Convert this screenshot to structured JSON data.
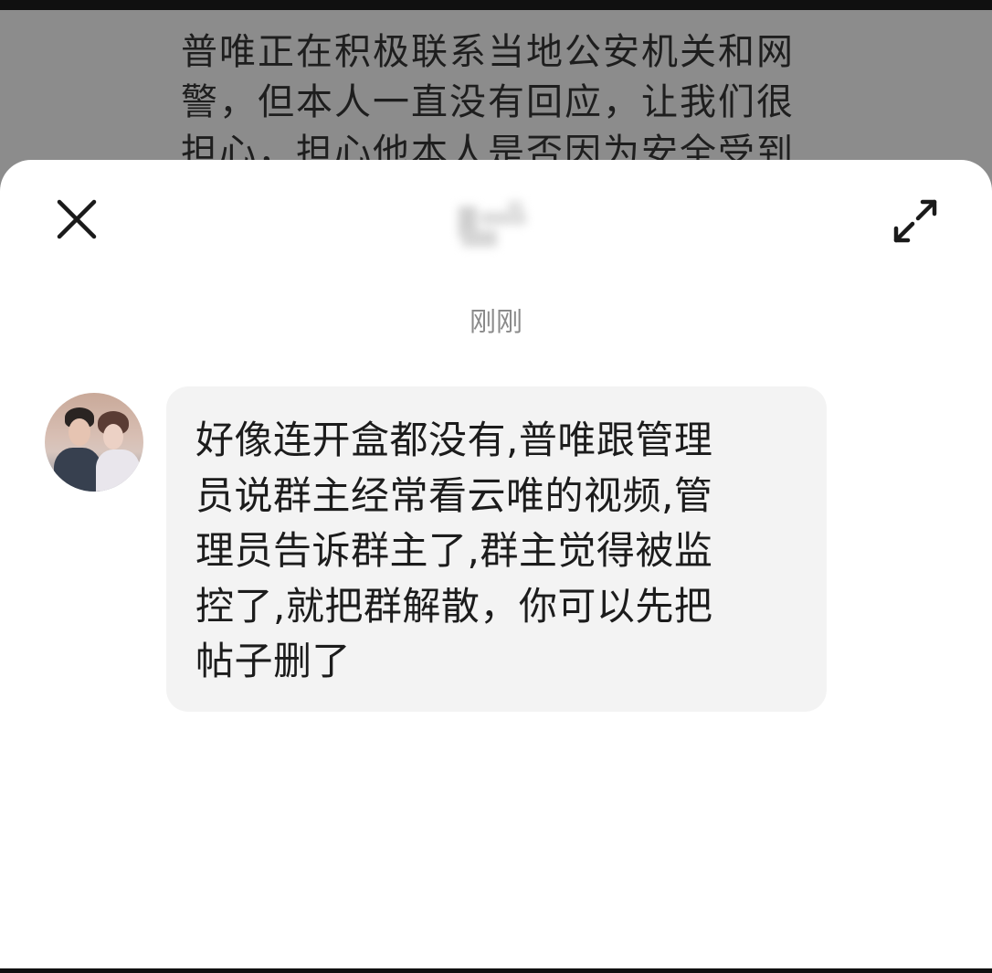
{
  "background_post": {
    "text": "普唯正在积极联系当地公安机关和网\n警，但本人一直没有回应，让我们很\n担心，担心他本人是否因为安全受到"
  },
  "header": {
    "close_icon": "close-icon",
    "expand_icon": "expand-arrows-icon"
  },
  "chat": {
    "timestamp": "刚刚",
    "messages": [
      {
        "sender": "other",
        "avatar": "avatar-photo",
        "text": "好像连开盒都没有,普唯跟管理\n员说群主经常看云唯的视频,管\n理员告诉群主了,群主觉得被监\n控了,就把群解散，你可以先把\n帖子删了"
      }
    ]
  },
  "colors": {
    "overlay": "#8c8c8c",
    "sheet": "#ffffff",
    "bubble": "#f3f3f3",
    "timestamp": "#8a8a8a",
    "text": "#1c1c1c"
  }
}
